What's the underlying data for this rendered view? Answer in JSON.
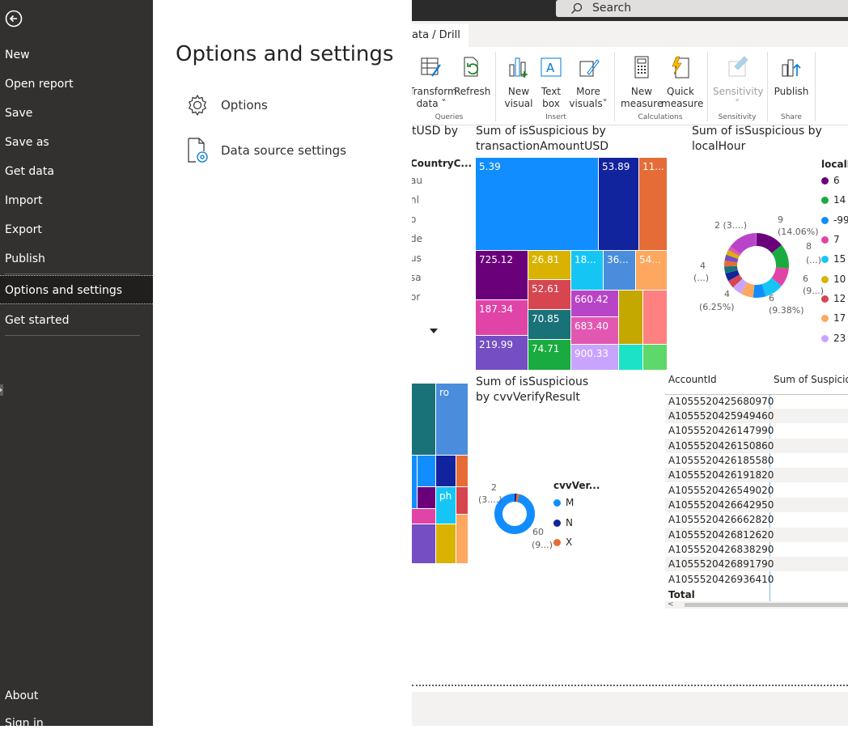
{
  "nav": {
    "items": [
      {
        "label": "New"
      },
      {
        "label": "Open report"
      },
      {
        "label": "Save"
      },
      {
        "label": "Save as"
      },
      {
        "label": "Get data"
      },
      {
        "label": "Import"
      },
      {
        "label": "Export"
      },
      {
        "label": "Publish"
      },
      {
        "label": "Options and settings"
      },
      {
        "label": "Get started"
      }
    ],
    "bottom": [
      {
        "label": "About"
      },
      {
        "label": "Sign in"
      }
    ]
  },
  "panel": {
    "title": "Options and settings",
    "options": [
      {
        "label": "Options",
        "icon": "gear-icon"
      },
      {
        "label": "Data source settings",
        "icon": "datasource-settings-icon"
      }
    ]
  },
  "report": {
    "search_placeholder": "Search",
    "tab_label": "ata / Drill",
    "ribbon": {
      "buttons": [
        {
          "label1": "Transform",
          "label2": "data",
          "chevron": "˅",
          "icon": "transform-data-icon"
        },
        {
          "label1": "Refresh",
          "label2": "",
          "icon": "refresh-icon"
        },
        {
          "label1": "New",
          "label2": "visual",
          "icon": "new-visual-icon"
        },
        {
          "label1": "Text",
          "label2": "box",
          "icon": "text-box-icon"
        },
        {
          "label1": "More",
          "label2": "visuals",
          "chevron": "˅",
          "icon": "more-visuals-icon"
        },
        {
          "label1": "New",
          "label2": "measure",
          "icon": "calculator-icon"
        },
        {
          "label1": "Quick",
          "label2": "measure",
          "icon": "quick-measure-icon"
        },
        {
          "label1": "Sensitivity",
          "label2": "˅",
          "icon": "sensitivity-icon"
        },
        {
          "label1": "Publish",
          "label2": "",
          "icon": "publish-icon"
        }
      ],
      "groups": [
        "Queries",
        "Insert",
        "Calculations",
        "Sensitivity",
        "Share"
      ]
    },
    "visual_left_title": "tUSD by",
    "slicer": {
      "header": "CountryC...",
      "items": [
        "au",
        "nl",
        "o",
        "de",
        "us",
        "sa",
        "or"
      ]
    },
    "treemap": {
      "title1": "Sum of isSuspicious by",
      "title2": "transactionAmountUSD",
      "labels": [
        "5.39",
        "53.89",
        "11...",
        "725.12",
        "26.81",
        "18...",
        "36...",
        "54...",
        "52.61",
        "187.34",
        "660.42",
        "70.85",
        "683.40",
        "219.99",
        "74.71",
        "900.33"
      ]
    },
    "donut1": {
      "title1": "Sum of isSuspicious by",
      "title2": "localHour",
      "legend_title": "localH",
      "legend": [
        "6",
        "14",
        "-99",
        "7",
        "15",
        "10",
        "12",
        "17",
        "23"
      ],
      "labels": [
        {
          "l1": "9",
          "l2": "(14.06%)"
        },
        {
          "l1": "8",
          "l2": "(...)"
        },
        {
          "l1": "6",
          "l2": "(9...)"
        },
        {
          "l1": "6",
          "l2": "(9.38%)"
        },
        {
          "l1": "4",
          "l2": "(6.25%)"
        },
        {
          "l1": "4",
          "l2": "(...)"
        },
        {
          "l1": "2 (3....)",
          "l2": ""
        }
      ]
    },
    "treemap2": {
      "labels": [
        "ro",
        "ph"
      ]
    },
    "donut2": {
      "title1": "Sum of isSuspicious",
      "title2": "by cvvVerifyResult",
      "legend_title": "cvvVer...",
      "legend": [
        "M",
        "N",
        "X"
      ],
      "label_small_1": "2",
      "label_small_2": "(3....)",
      "label_big_1": "60",
      "label_big_2": "(9...)"
    },
    "table": {
      "col1": "AccountId",
      "col2": "Sum of Suspicio",
      "rows": [
        "A1055520425680970",
        "A1055520425949460",
        "A1055520426147990",
        "A1055520426150860",
        "A1055520426185580",
        "A1055520426191820",
        "A1055520426549020",
        "A1055520426642950",
        "A1055520426662820",
        "A1055520426812620",
        "A1055520426838290",
        "A1055520426891790",
        "A1055520426936410"
      ],
      "total": "Total"
    },
    "colors": {
      "blue": "#118DFF",
      "navy": "#12239E",
      "orange": "#E66C37",
      "purple": "#6B007B",
      "pink": "#E044A7",
      "violet": "#744EC2",
      "yellow": "#D9B300",
      "red": "#D64550",
      "teal": "#197278",
      "cyan": "#1AAB40",
      "sky": "#15C6F4",
      "green": "#1AAB40"
    }
  }
}
